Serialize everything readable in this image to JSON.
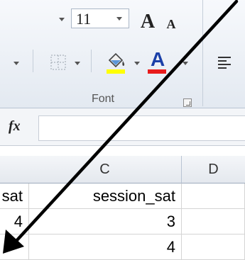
{
  "ribbon": {
    "font_size": "11",
    "grow_font_glyph": "A",
    "shrink_font_glyph": "A",
    "font_color_letter": "A",
    "group_label": "Font",
    "highlight_color": "#ffff00",
    "font_color": "#e81b1b"
  },
  "formula_bar": {
    "fx_label": "fx",
    "formula": ""
  },
  "columns": [
    "C",
    "D"
  ],
  "rows": [
    {
      "b": "sat",
      "c": "session_sat",
      "d": ""
    },
    {
      "b": "4",
      "c": "3",
      "d": ""
    },
    {
      "b": "",
      "c": "4",
      "d": ""
    }
  ]
}
